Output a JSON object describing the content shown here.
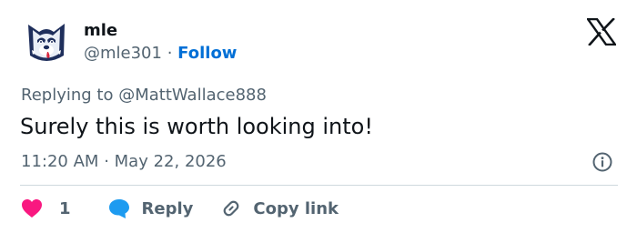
{
  "author": {
    "name": "mle",
    "handle": "@mle301",
    "separator": "·",
    "follow_label": "Follow",
    "avatar_icon": "husky-mascot-avatar"
  },
  "header": {
    "logo_icon": "x-logo-icon"
  },
  "tweet": {
    "replying_prefix": "Replying to",
    "replying_to": "@MattWallace888",
    "text": "Surely this is worth looking into!",
    "time": "11:20 AM",
    "date_separator": "·",
    "date": "May 22, 2026"
  },
  "actions": {
    "like_count": "1",
    "reply_label": "Reply",
    "copy_link_label": "Copy link"
  },
  "colors": {
    "accent": "#006fd6",
    "heart": "#f91880",
    "reply_bubble": "#1d9bf0",
    "secondary_text": "#536471",
    "primary_text": "#0f1419",
    "divider": "#cfd9de"
  }
}
